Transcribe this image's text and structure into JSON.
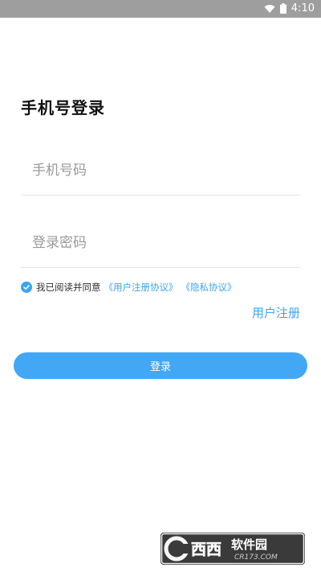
{
  "status_bar": {
    "time": "4:10"
  },
  "title": "手机号登录",
  "form": {
    "phone_placeholder": "手机号码",
    "password_placeholder": "登录密码"
  },
  "agreement": {
    "prefix": "我已阅读并同意",
    "user_agreement": "《用户注册协议》",
    "privacy_policy": "《隐私协议》",
    "checked": true
  },
  "register_label": "用户注册",
  "login_label": "登录",
  "watermark": {
    "name": "西西软件园",
    "domain": "CR173.COM"
  },
  "colors": {
    "accent": "#42a7f5",
    "status_bar": "#9e9e9e"
  }
}
